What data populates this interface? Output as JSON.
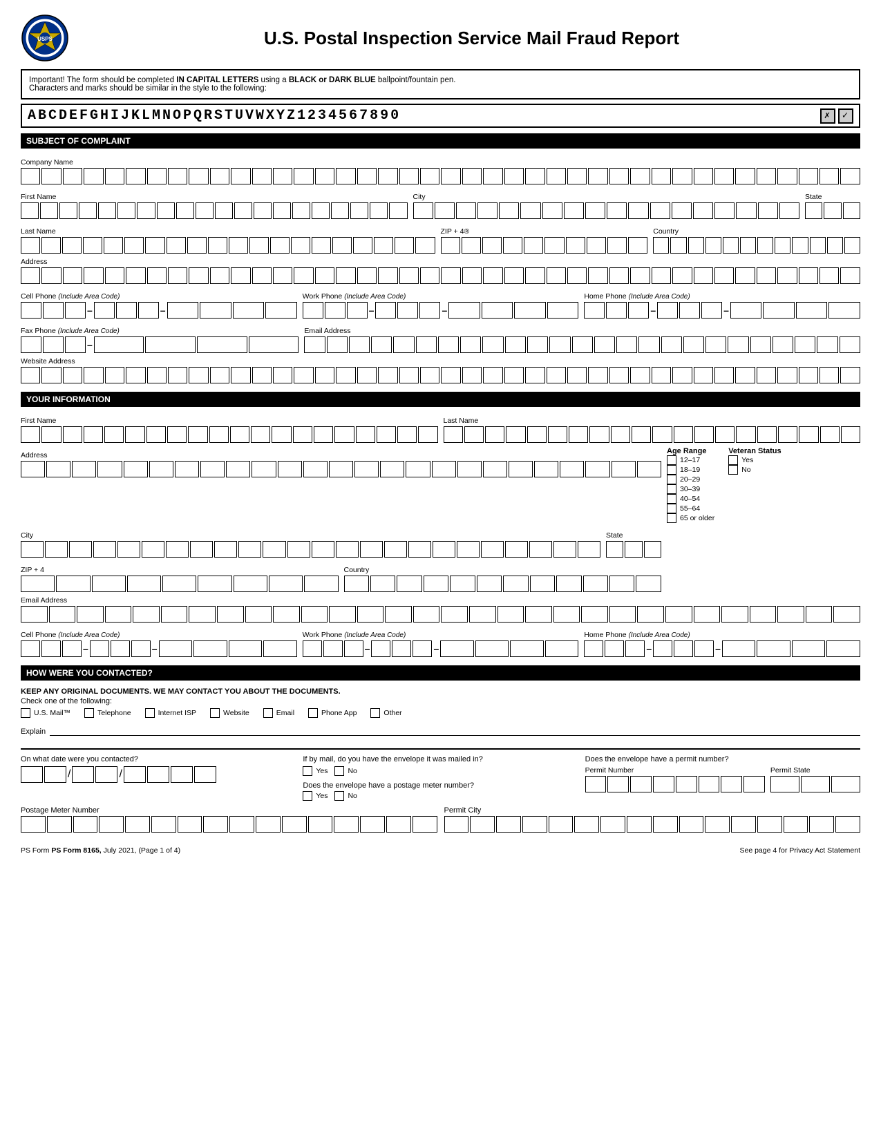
{
  "header": {
    "title": "U.S. Postal Inspection Service Mail Fraud Report",
    "logo_alt": "USPS Eagle Logo"
  },
  "instruction": {
    "line1": "Important! The form should be completed IN CAPITAL LETTERS using a BLACK or DARK BLUE ballpoint/fountain pen.",
    "line2": "Characters and marks should be similar in the style to the following:",
    "alphabet": "ABCDEFGHIJKLMNOPQRSTUVWXYZ1234567890"
  },
  "sections": {
    "subject": "SUBJECT OF COMPLAINT",
    "your_info": "YOUR INFORMATION",
    "how_contacted": "HOW WERE YOU CONTACTED?"
  },
  "subject_form": {
    "company_name_label": "Company Name",
    "first_name_label": "First Name",
    "city_label": "City",
    "state_label": "State",
    "last_name_label": "Last Name",
    "zip_label": "ZIP + 4®",
    "country_label": "Country",
    "address_label": "Address",
    "cell_phone_label": "Cell Phone (Include Area Code)",
    "work_phone_label": "Work Phone (Include Area Code)",
    "home_phone_label": "Home Phone (Include Area Code)",
    "fax_phone_label": "Fax Phone (Include Area Code)",
    "email_label": "Email Address",
    "website_label": "Website Address"
  },
  "your_info_form": {
    "first_name_label": "First Name",
    "last_name_label": "Last Name",
    "address_label": "Address",
    "city_label": "City",
    "state_label": "State",
    "zip_label": "ZIP + 4",
    "country_label": "Country",
    "email_label": "Email Address",
    "cell_phone_label": "Cell Phone (Include Area Code)",
    "work_phone_label": "Work Phone (Include Area Code)",
    "home_phone_label": "Home Phone (Include Area Code)",
    "age_range_heading": "Age Range",
    "veteran_heading": "Veteran Status",
    "age_ranges": [
      "12–17",
      "18–19",
      "20–29",
      "30–39",
      "40–54",
      "55–64",
      "65 or older"
    ],
    "veteran_options": [
      "Yes",
      "No"
    ]
  },
  "how_contacted": {
    "keep_docs_text": "KEEP ANY ORIGINAL DOCUMENTS. WE MAY CONTACT YOU ABOUT THE DOCUMENTS.",
    "check_one_text": "Check one of the following:",
    "options": [
      "U.S. Mail™",
      "Telephone",
      "Internet ISP",
      "Website",
      "Email",
      "Phone App",
      "Other"
    ],
    "explain_label": "Explain"
  },
  "bottom_section": {
    "date_label": "On what date were you contacted?",
    "envelope_q": "If by mail, do you have the envelope it was mailed in?",
    "permit_q": "Does the envelope have a permit number?",
    "yes_label": "Yes",
    "no_label": "No",
    "postage_meter_q": "Does the envelope have a postage meter number?",
    "postage_meter_label": "Postage Meter Number",
    "permit_number_label": "Permit Number",
    "permit_state_label": "Permit State",
    "permit_city_label": "Permit City"
  },
  "footer": {
    "form_id": "PS Form 8165,",
    "date": "July 2021,",
    "page": "(Page 1 of 4)",
    "privacy": "See page 4 for Privacy Act Statement"
  }
}
